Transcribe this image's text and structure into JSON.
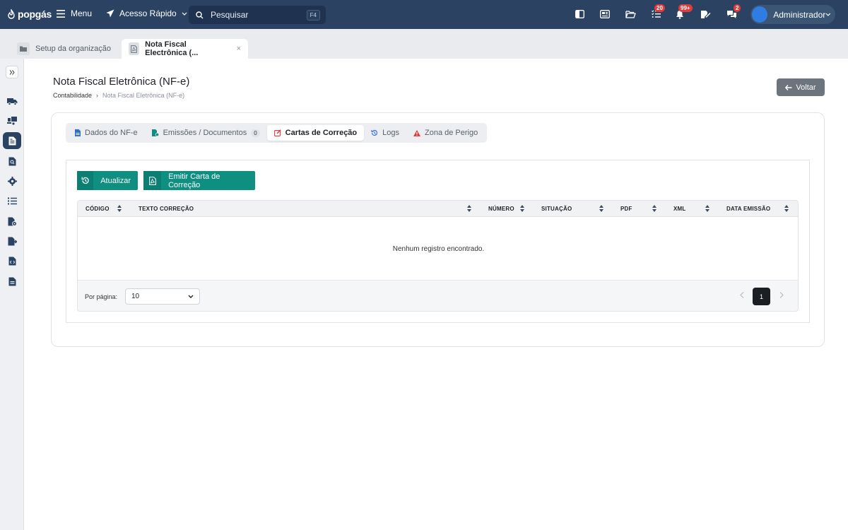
{
  "topbar": {
    "logo": "popgás",
    "menu_label": "Menu",
    "quick_access_label": "Acesso Rápido",
    "search_placeholder": "Pesquisar",
    "search_shortcut": "F4",
    "tasks_badge": "20",
    "notifications_badge": "99+",
    "messages_badge": "2",
    "user_name": "Administrador"
  },
  "tabs_bar": {
    "tabs": [
      {
        "label": "Setup da organização"
      },
      {
        "label": "Nota Fiscal Electrônica (..."
      }
    ],
    "close_glyph": "×"
  },
  "page": {
    "title": "Nota Fiscal Eletrônica (NF-e)",
    "breadcrumb": [
      "Contabilidade",
      "›",
      "Nota Fiscal Eletrônica (NF-e)"
    ],
    "back_label": "Voltar"
  },
  "content_tabs": [
    {
      "label": "Dados do NF-e",
      "icon": "file-icon"
    },
    {
      "label": "Emissões / Documentos",
      "icon": "file-gear-icon",
      "count": "0"
    },
    {
      "label": "Cartas de Correção",
      "icon": "edit-icon",
      "active": true
    },
    {
      "label": "Logs",
      "icon": "history-icon"
    },
    {
      "label": "Zona de Perigo",
      "icon": "warning-icon"
    }
  ],
  "toolbar": {
    "refresh_label": "Atualizar",
    "emit_label": "Emitir Carta de Correção"
  },
  "table": {
    "columns": [
      "CÓDIGO",
      "TEXTO CORREÇÃO",
      "NÚMERO",
      "SITUAÇÃO",
      "PDF",
      "XML",
      "DATA EMISSÃO"
    ],
    "empty_message": "Nenhum registro encontrado.",
    "per_page_label": "Por página:",
    "per_page_value": "10",
    "current_page": "1"
  },
  "colors": {
    "topbar": "#2b4263",
    "teal": "#0e8f7f",
    "danger": "#e23b3b"
  }
}
